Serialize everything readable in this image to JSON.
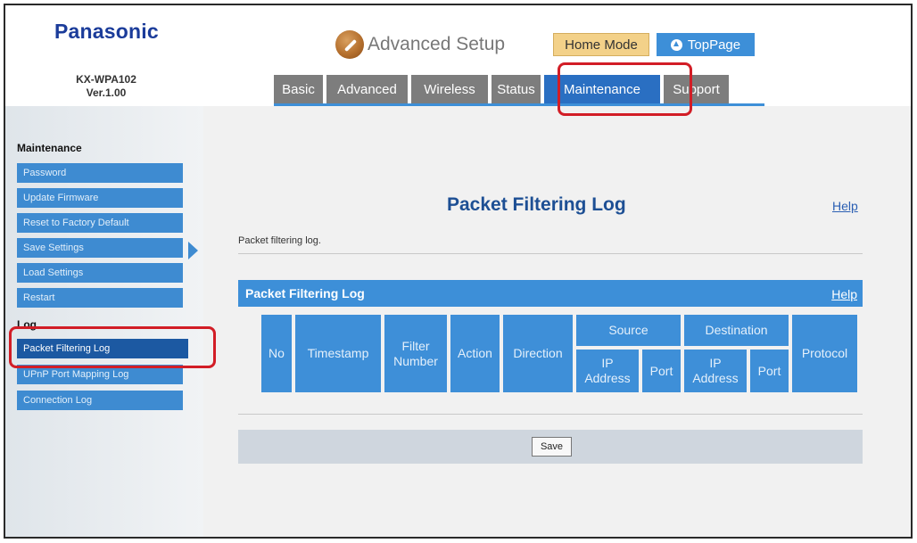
{
  "brand": {
    "name": "Panasonic",
    "model": "KX-WPA102",
    "version": "Ver.1.00"
  },
  "header": {
    "title": "Advanced Setup",
    "home_mode": "Home Mode",
    "top_page": "TopPage",
    "tabs": [
      {
        "label": "Basic",
        "active": false
      },
      {
        "label": "Advanced",
        "active": false
      },
      {
        "label": "Wireless",
        "active": false
      },
      {
        "label": "Status",
        "active": false
      },
      {
        "label": "Maintenance",
        "active": true
      },
      {
        "label": "Support",
        "active": false
      }
    ]
  },
  "sidebar": {
    "maintenance_heading": "Maintenance",
    "maintenance_items": [
      {
        "label": "Password"
      },
      {
        "label": "Update Firmware"
      },
      {
        "label": "Reset to Factory Default"
      },
      {
        "label": "Save Settings"
      },
      {
        "label": "Load Settings"
      },
      {
        "label": "Restart"
      }
    ],
    "log_heading": "Log",
    "log_items": [
      {
        "label": "Packet Filtering Log",
        "active": true
      },
      {
        "label": "UPnP Port Mapping Log",
        "active": false
      },
      {
        "label": "Connection Log",
        "active": false
      }
    ]
  },
  "main": {
    "page_title": "Packet Filtering Log",
    "help": "Help",
    "description": "Packet filtering log.",
    "table": {
      "title": "Packet Filtering Log",
      "help": "Help",
      "columns": {
        "no": "No",
        "timestamp": "Timestamp",
        "filter_number": "Filter Number",
        "action": "Action",
        "direction": "Direction",
        "source": "Source",
        "destination": "Destination",
        "ip_address": "IP Address",
        "port": "Port",
        "protocol": "Protocol"
      }
    },
    "save_button": "Save"
  },
  "colors": {
    "brand_blue": "#1b3c9a",
    "tab_active": "#2a6fc2",
    "tab_inactive": "#7d7d7d",
    "accent_blue": "#3d8fd8",
    "highlight_red": "#d21d26",
    "home_mode_bg": "#f3d189"
  },
  "icons": {
    "title_icon": "wrench-icon",
    "top_page_icon": "up-arrow-icon",
    "sidebar_arrow": "play-arrow-icon"
  }
}
